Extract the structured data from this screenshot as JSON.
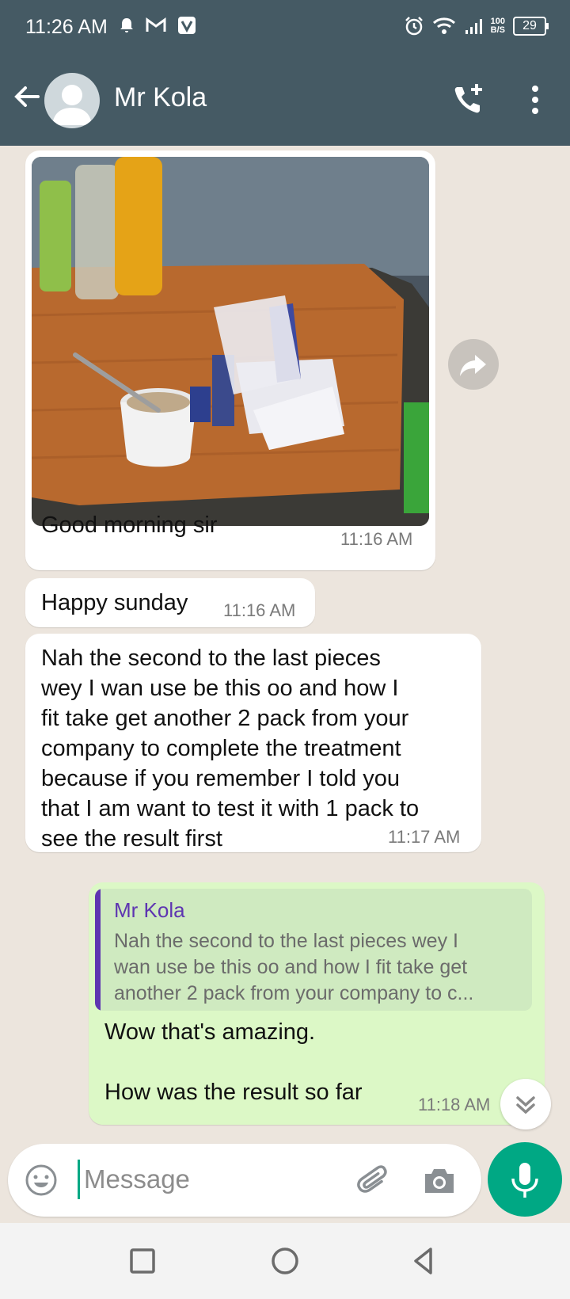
{
  "status_bar": {
    "time": "11:26 AM",
    "net_speed_value": "100",
    "net_speed_unit": "B/S",
    "battery": "29"
  },
  "header": {
    "contact_name": "Mr Kola"
  },
  "messages": [
    {
      "caption": "Good morning sir",
      "time": "11:16 AM"
    },
    {
      "text": "Happy sunday",
      "time": "11:16 AM"
    },
    {
      "lines": [
        "Nah the second to the last pieces",
        "wey I wan use be this oo and how I",
        "fit take get another 2 pack from your",
        "company to complete the treatment",
        "because if you remember I told you",
        "that I am want to test it with 1 pack to",
        "see the result first"
      ],
      "time": "11:17 AM"
    },
    {
      "quote_name": "Mr Kola",
      "quote_lines": [
        "Nah the second to the last pieces wey I",
        "wan use be this oo and how I fit take get",
        "another 2 pack from your company to c..."
      ],
      "line1": "Wow that's amazing.",
      "line2": "How was the result so far",
      "time": "11:18 AM"
    }
  ],
  "composer": {
    "placeholder": "Message"
  },
  "colors": {
    "header": "#455a64",
    "chat_bg": "#ece5dd",
    "incoming": "#ffffff",
    "outgoing": "#dcf8c6",
    "accent": "#00a884",
    "quote_accent": "#5e35b1"
  },
  "icons": [
    "bell-icon",
    "gmail-icon",
    "v-app-icon",
    "alarm-icon",
    "wifi-icon",
    "signal-icon",
    "battery-icon",
    "back-arrow-icon",
    "add-call-icon",
    "more-vert-icon",
    "forward-icon",
    "chevron-double-down-icon",
    "emoji-icon",
    "attach-icon",
    "camera-icon",
    "mic-icon",
    "recent-apps-icon",
    "home-icon",
    "back-nav-icon"
  ]
}
